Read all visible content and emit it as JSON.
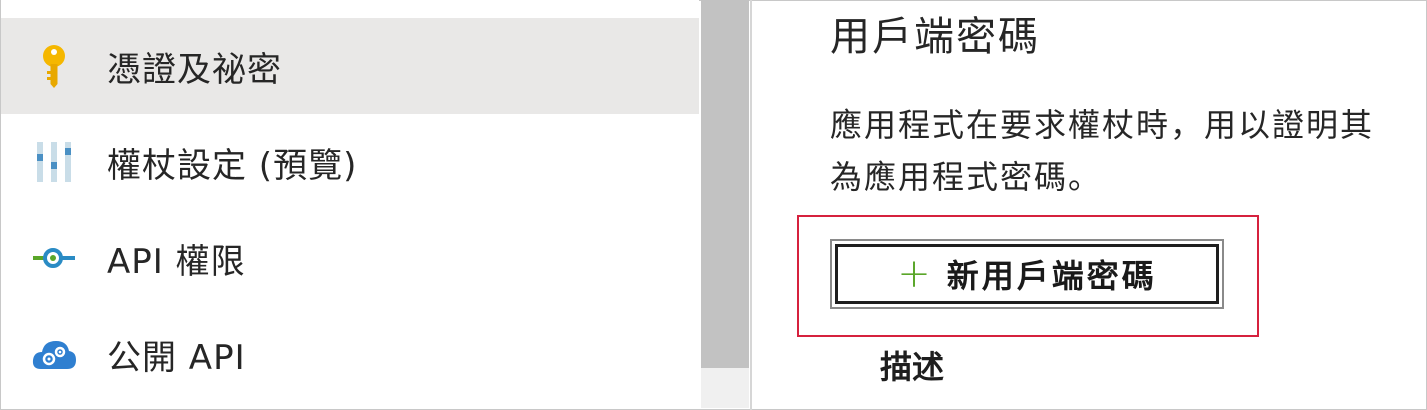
{
  "nav": {
    "items": [
      {
        "label": "憑證及祕密",
        "icon": "key-icon",
        "selected": true
      },
      {
        "label": "權杖設定 (預覽)",
        "icon": "sliders-icon",
        "selected": false
      },
      {
        "label": "API 權限",
        "icon": "api-permissions-icon",
        "selected": false
      },
      {
        "label": "公開 API",
        "icon": "cloud-gear-icon",
        "selected": false
      }
    ]
  },
  "main": {
    "title": "用戶端密碼",
    "description_line1": "應用程式在要求權杖時，用以證明其",
    "description_line2": "為應用程式密碼。",
    "new_secret_button": {
      "icon": "plus-icon",
      "label": "新用戶端密碼"
    },
    "column_header": "描述"
  },
  "colors": {
    "selected_bg": "#e9e8e7",
    "highlight_border": "#d6213e",
    "plus_green": "#5aa629",
    "key_yellow": "#f5b700"
  }
}
